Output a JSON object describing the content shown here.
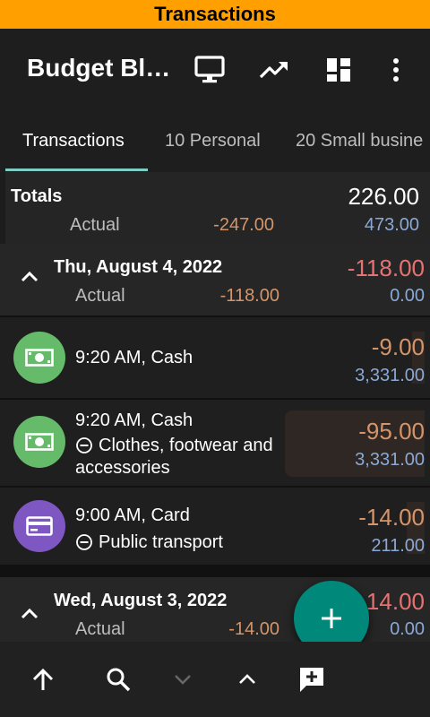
{
  "banner": {
    "title": "Transactions"
  },
  "appbar": {
    "title": "Budget Bl…"
  },
  "tabs": [
    {
      "label": "Transactions"
    },
    {
      "label": "10 Personal"
    },
    {
      "label": "20 Small busine"
    }
  ],
  "totals": {
    "label": "Totals",
    "value": "226.00",
    "actual_label": "Actual",
    "actual_value": "-247.00",
    "actual_right": "473.00"
  },
  "days": [
    {
      "date": "Thu, August 4, 2022",
      "total": "-118.00",
      "actual_label": "Actual",
      "actual_value": "-118.00",
      "actual_right": "0.00"
    },
    {
      "date": "Wed, August 3, 2022",
      "total": "-14.00",
      "actual_label": "Actual",
      "actual_value": "-14.00",
      "actual_right": "0.00"
    }
  ],
  "transactions": [
    {
      "time": "9:20 AM, Cash",
      "category": "",
      "amount": "-9.00",
      "balance": "3,331.00",
      "icon": "cash-icon",
      "color": "#66bb6a"
    },
    {
      "time": "9:20 AM, Cash",
      "category": "Clothes, footwear and",
      "category2": "accessories",
      "amount": "-95.00",
      "balance": "3,331.00",
      "icon": "cash-icon",
      "color": "#66bb6a"
    },
    {
      "time": "9:00 AM, Card",
      "category": "Public transport",
      "amount": "-14.00",
      "balance": "211.00",
      "icon": "card-icon",
      "color": "#7e57c2"
    }
  ],
  "colors": {
    "accent": "#ffa000",
    "fab": "#00897b",
    "indicator": "#80cbc4"
  }
}
